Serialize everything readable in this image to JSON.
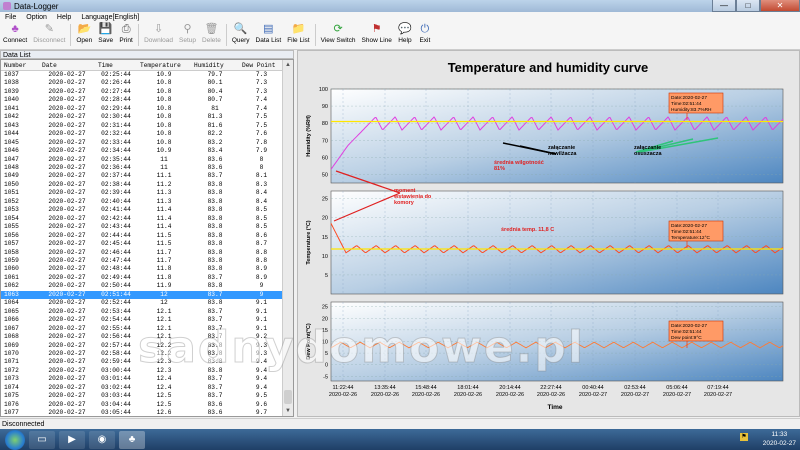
{
  "window": {
    "title": "Data-Logger",
    "btn_min": "—",
    "btn_max": "□",
    "btn_close": "✕"
  },
  "menu": [
    "File",
    "Option",
    "Help",
    "Language[English]"
  ],
  "toolbar": [
    {
      "label": "Connect",
      "icon": "♣",
      "color": "#b04fc9",
      "disabled": false,
      "name": "connect"
    },
    {
      "label": "Disconnect",
      "icon": "✎",
      "color": "#999",
      "disabled": true,
      "name": "disconnect"
    },
    {
      "label": "Open",
      "icon": "📂",
      "color": "#d9a531",
      "disabled": false,
      "name": "open"
    },
    {
      "label": "Save",
      "icon": "💾",
      "color": "#3a67b5",
      "disabled": false,
      "name": "save"
    },
    {
      "label": "Print",
      "icon": "⎙",
      "color": "#555",
      "disabled": false,
      "name": "print"
    },
    {
      "label": "Download",
      "icon": "⇩",
      "color": "#999",
      "disabled": true,
      "name": "download"
    },
    {
      "label": "Setup",
      "icon": "⚲",
      "color": "#999",
      "disabled": true,
      "name": "setup"
    },
    {
      "label": "Delete",
      "icon": "🗑",
      "color": "#999",
      "disabled": true,
      "name": "delete"
    },
    {
      "label": "Query",
      "icon": "🔍",
      "color": "#3a67b5",
      "disabled": false,
      "name": "query"
    },
    {
      "label": "Data List",
      "icon": "▤",
      "color": "#3a67b5",
      "disabled": false,
      "name": "data-list"
    },
    {
      "label": "File List",
      "icon": "📁",
      "color": "#d9a531",
      "disabled": false,
      "name": "file-list"
    },
    {
      "label": "View Switch",
      "icon": "⟳",
      "color": "#2fa33a",
      "disabled": false,
      "name": "view-switch"
    },
    {
      "label": "Show Line",
      "icon": "⚑",
      "color": "#c03030",
      "disabled": false,
      "name": "show-line"
    },
    {
      "label": "Help",
      "icon": "💬",
      "color": "#3a8ad6",
      "disabled": false,
      "name": "help"
    },
    {
      "label": "Exit",
      "icon": "⏻",
      "color": "#3a67b5",
      "disabled": false,
      "name": "exit"
    }
  ],
  "data_list": {
    "header": "Data List",
    "columns": [
      "Number",
      "Date",
      "Time",
      "Temperature",
      "Humidity",
      "Dew Point"
    ],
    "selected_index": 26,
    "rows": [
      [
        "1037",
        "2020-02-27",
        "02:25:44",
        "10.9",
        "79.7",
        "7.3"
      ],
      [
        "1038",
        "2020-02-27",
        "02:26:44",
        "10.8",
        "80.1",
        "7.3"
      ],
      [
        "1039",
        "2020-02-27",
        "02:27:44",
        "10.8",
        "80.4",
        "7.3"
      ],
      [
        "1040",
        "2020-02-27",
        "02:28:44",
        "10.8",
        "80.7",
        "7.4"
      ],
      [
        "1041",
        "2020-02-27",
        "02:29:44",
        "10.8",
        "81",
        "7.4"
      ],
      [
        "1042",
        "2020-02-27",
        "02:30:44",
        "10.8",
        "81.3",
        "7.5"
      ],
      [
        "1043",
        "2020-02-27",
        "02:31:44",
        "10.8",
        "81.6",
        "7.5"
      ],
      [
        "1044",
        "2020-02-27",
        "02:32:44",
        "10.8",
        "82.2",
        "7.6"
      ],
      [
        "1045",
        "2020-02-27",
        "02:33:44",
        "10.8",
        "83.2",
        "7.8"
      ],
      [
        "1046",
        "2020-02-27",
        "02:34:44",
        "10.9",
        "83.4",
        "7.9"
      ],
      [
        "1047",
        "2020-02-27",
        "02:35:44",
        "11",
        "83.6",
        "8"
      ],
      [
        "1048",
        "2020-02-27",
        "02:36:44",
        "11",
        "83.6",
        "8"
      ],
      [
        "1049",
        "2020-02-27",
        "02:37:44",
        "11.1",
        "83.7",
        "8.1"
      ],
      [
        "1050",
        "2020-02-27",
        "02:38:44",
        "11.2",
        "83.8",
        "8.3"
      ],
      [
        "1051",
        "2020-02-27",
        "02:39:44",
        "11.3",
        "83.8",
        "8.4"
      ],
      [
        "1052",
        "2020-02-27",
        "02:40:44",
        "11.3",
        "83.8",
        "8.4"
      ],
      [
        "1053",
        "2020-02-27",
        "02:41:44",
        "11.4",
        "83.8",
        "8.5"
      ],
      [
        "1054",
        "2020-02-27",
        "02:42:44",
        "11.4",
        "83.8",
        "8.5"
      ],
      [
        "1055",
        "2020-02-27",
        "02:43:44",
        "11.4",
        "83.8",
        "8.5"
      ],
      [
        "1056",
        "2020-02-27",
        "02:44:44",
        "11.5",
        "83.8",
        "8.6"
      ],
      [
        "1057",
        "2020-02-27",
        "02:45:44",
        "11.5",
        "83.8",
        "8.7"
      ],
      [
        "1058",
        "2020-02-27",
        "02:46:44",
        "11.7",
        "83.8",
        "8.8"
      ],
      [
        "1059",
        "2020-02-27",
        "02:47:44",
        "11.7",
        "83.8",
        "8.8"
      ],
      [
        "1060",
        "2020-02-27",
        "02:48:44",
        "11.8",
        "83.8",
        "8.9"
      ],
      [
        "1061",
        "2020-02-27",
        "02:49:44",
        "11.8",
        "83.7",
        "8.9"
      ],
      [
        "1062",
        "2020-02-27",
        "02:50:44",
        "11.9",
        "83.8",
        "9"
      ],
      [
        "1063",
        "2020-02-27",
        "02:51:44",
        "12",
        "83.7",
        "9"
      ],
      [
        "1064",
        "2020-02-27",
        "02:52:44",
        "12",
        "83.8",
        "9.1"
      ],
      [
        "1065",
        "2020-02-27",
        "02:53:44",
        "12.1",
        "83.7",
        "9.1"
      ],
      [
        "1066",
        "2020-02-27",
        "02:54:44",
        "12.1",
        "83.7",
        "9.1"
      ],
      [
        "1067",
        "2020-02-27",
        "02:55:44",
        "12.1",
        "83.7",
        "9.1"
      ],
      [
        "1068",
        "2020-02-27",
        "02:56:44",
        "12.1",
        "83.7",
        "9.2"
      ],
      [
        "1069",
        "2020-02-27",
        "02:57:44",
        "12.2",
        "83.8",
        "9.3"
      ],
      [
        "1070",
        "2020-02-27",
        "02:58:44",
        "12.2",
        "83.8",
        "9.3"
      ],
      [
        "1071",
        "2020-02-27",
        "02:59:44",
        "12.3",
        "83.8",
        "9.4"
      ],
      [
        "1072",
        "2020-02-27",
        "03:00:44",
        "12.3",
        "83.8",
        "9.4"
      ],
      [
        "1073",
        "2020-02-27",
        "03:01:44",
        "12.4",
        "83.7",
        "9.4"
      ],
      [
        "1074",
        "2020-02-27",
        "03:02:44",
        "12.4",
        "83.7",
        "9.4"
      ],
      [
        "1075",
        "2020-02-27",
        "03:03:44",
        "12.5",
        "83.7",
        "9.5"
      ],
      [
        "1076",
        "2020-02-27",
        "03:04:44",
        "12.5",
        "83.6",
        "9.6"
      ],
      [
        "1077",
        "2020-02-27",
        "03:05:44",
        "12.6",
        "83.6",
        "9.7"
      ],
      [
        "1078",
        "2020-02-27",
        "03:06:44",
        "12.6",
        "83.7",
        "9.7"
      ],
      [
        "1079",
        "2020-02-27",
        "03:07:44",
        "12.7",
        "83.6",
        "9.7"
      ],
      [
        "1080",
        "2020-02-27",
        "03:08:44",
        "12.7",
        "83.3",
        "9.7"
      ],
      [
        "1081",
        "2020-02-27",
        "03:09:44",
        "12.7",
        "83.2",
        "9.7"
      ],
      [
        "1082",
        "2020-02-27",
        "03:10:44",
        "12.7",
        "82.9",
        "9.6"
      ],
      [
        "1083",
        "2020-02-27",
        "03:11:44",
        "12.7",
        "82.6",
        "9.5"
      ]
    ]
  },
  "chart": {
    "title": "Temperature and humidity curve",
    "xlabel": "Time",
    "x_ticks": [
      {
        "time": "11:22:44",
        "date": "2020-02-26"
      },
      {
        "time": "13:35:44",
        "date": "2020-02-26"
      },
      {
        "time": "15:48:44",
        "date": "2020-02-26"
      },
      {
        "time": "18:01:44",
        "date": "2020-02-26"
      },
      {
        "time": "20:14:44",
        "date": "2020-02-26"
      },
      {
        "time": "22:27:44",
        "date": "2020-02-26"
      },
      {
        "time": "00:40:44",
        "date": "2020-02-27"
      },
      {
        "time": "02:53:44",
        "date": "2020-02-27"
      },
      {
        "time": "05:06:44",
        "date": "2020-02-27"
      },
      {
        "time": "07:19:44",
        "date": "2020-02-27"
      }
    ],
    "humidity_ticks": [
      "100",
      "90",
      "80",
      "70",
      "60",
      "50"
    ],
    "temperature_ticks": [
      "25",
      "20",
      "15",
      "10",
      "5"
    ],
    "dew_ticks": [
      "25",
      "20",
      "15",
      "10",
      "5",
      "0",
      "-5"
    ],
    "humidity_label": "Humidity (%RH)",
    "temperature_label": "Temperature (°C)",
    "dew_label": "Dew Point(°C)",
    "humidity_tooltip": [
      "Date:2020-02-27",
      "Time:02:51:44",
      "Humidity:83.7%RH"
    ],
    "temperature_tooltip": [
      "Date:2020-02-27",
      "Time:02:51:44",
      "Temperature:12°C"
    ],
    "dew_tooltip": [
      "Date:2020-02-27",
      "Time:02:51:44",
      "Dew point:9°C"
    ],
    "annotations": {
      "nawilzacz": [
        "załączanie",
        "nawilżacza"
      ],
      "osuszacz": [
        "załączanie",
        "osuszacza"
      ],
      "srednia_wilg": [
        "średnia wilgotność",
        "81%"
      ],
      "moment": [
        "moment",
        "wstawienia do",
        "komory"
      ],
      "srednia_temp": "średnia temp. 11,8 C"
    },
    "colors": {
      "humidity": "#e040e0",
      "temperature": "#ff4a20",
      "dew": "#ff7a33",
      "average": "#ffe600",
      "annotation": "#e02020"
    }
  },
  "chart_data": [
    {
      "type": "line",
      "title": "Temperature and humidity curve",
      "ylabel": "Humidity (%RH)",
      "ylim": [
        45,
        100
      ],
      "series": [
        {
          "name": "Humidity",
          "values": [
            53,
            57,
            65,
            70,
            75,
            80,
            82,
            83.7,
            79.7,
            82,
            83.7
          ],
          "avg": 81
        }
      ]
    },
    {
      "type": "line",
      "ylabel": "Temperature (°C)",
      "ylim": [
        0,
        27
      ],
      "series": [
        {
          "name": "Temperature",
          "values": [
            18.5,
            12,
            10.8,
            12.7,
            10.8,
            12.7,
            10.8,
            12.7
          ],
          "avg": 11.8
        }
      ]
    },
    {
      "type": "line",
      "ylabel": "Dew Point(°C)",
      "ylim": [
        -7,
        27
      ],
      "series": [
        {
          "name": "Dew Point",
          "values": [
            10,
            7.3,
            9.7,
            7.3,
            9.7,
            7.3,
            9.7
          ]
        }
      ]
    }
  ],
  "status": "Disconnected",
  "taskbar": {
    "time": "11:33",
    "date": "2020-02-27"
  },
  "watermark": "sadnydomowe.pl"
}
